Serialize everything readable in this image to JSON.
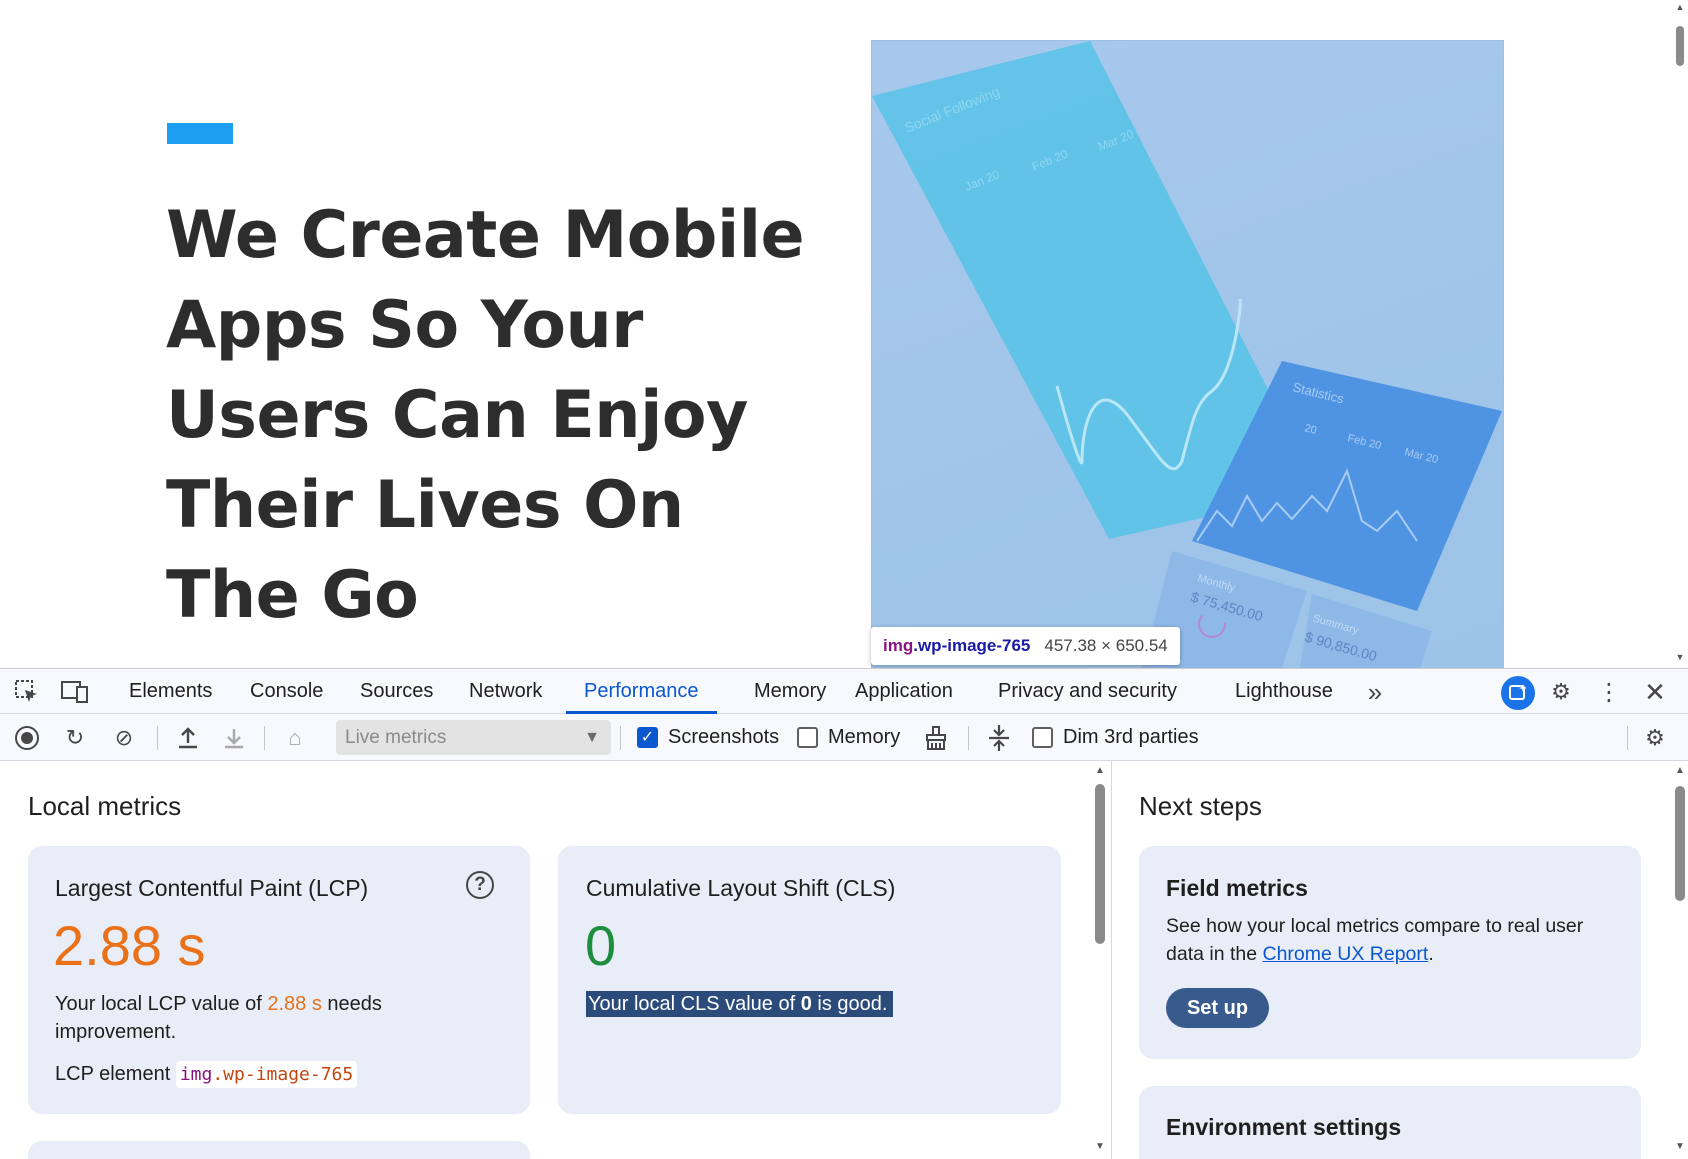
{
  "page": {
    "hero_title": "We Create Mobile Apps So Your Users Can Enjoy Their Lives On The Go",
    "image_text": {
      "social_following": "Social Following",
      "months_a": [
        "Jan 20",
        "Feb 20",
        "Mar 20"
      ],
      "statistics": "Statistics",
      "months_b": [
        "20",
        "Feb 20",
        "Mar 20"
      ],
      "monthly_label": "Monthly",
      "monthly_value": "$ 75,450.00",
      "summary_label": "Summary",
      "summary_value": "$ 90,850.00"
    },
    "tooltip": {
      "tag": "img",
      "class_name": ".wp-image-765",
      "dimensions": "457.38 × 650.54"
    }
  },
  "devtools": {
    "tabs": [
      "Elements",
      "Console",
      "Sources",
      "Network",
      "Performance",
      "Memory",
      "Application",
      "Privacy and security",
      "Lighthouse"
    ],
    "active_tab": "Performance",
    "more_tabs": "»",
    "toolbar": {
      "select_value": "Live metrics",
      "screenshots_label": "Screenshots",
      "screenshots_checked": true,
      "memory_label": "Memory",
      "memory_checked": false,
      "dim_label": "Dim 3rd parties",
      "dim_checked": false
    },
    "local_metrics": {
      "heading": "Local metrics",
      "lcp": {
        "title": "Largest Contentful Paint (LCP)",
        "value": "2.88 s",
        "desc_prefix": "Your local LCP value of ",
        "desc_value": "2.88 s",
        "desc_suffix": " needs improvement.",
        "element_label": "LCP element",
        "element_tag": "img",
        "element_class": ".wp-image-765",
        "color": "#e8711a"
      },
      "cls": {
        "title": "Cumulative Layout Shift (CLS)",
        "value": "0",
        "desc_prefix": "Your local CLS value of ",
        "desc_value": "0",
        "desc_suffix": " is good.",
        "color": "#1e8e3e"
      }
    },
    "next_steps": {
      "heading": "Next steps",
      "field_metrics": {
        "title": "Field metrics",
        "desc_prefix": "See how your local metrics compare to real user data in the ",
        "link": "Chrome UX Report",
        "desc_suffix": ".",
        "button": "Set up"
      },
      "environment": {
        "title": "Environment settings"
      }
    }
  }
}
